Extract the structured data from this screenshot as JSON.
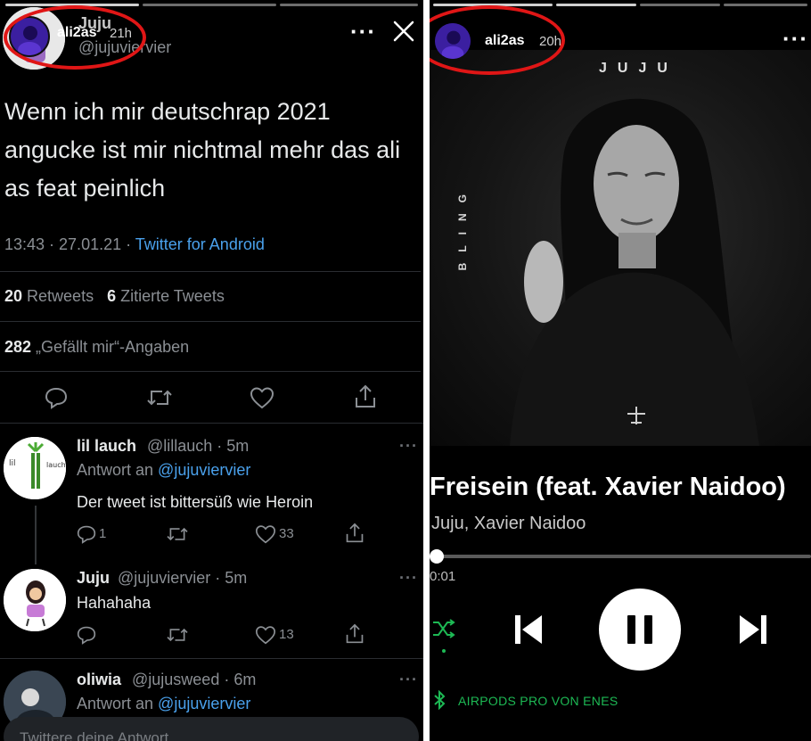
{
  "left_story": {
    "username": "ali2as",
    "time": "21h",
    "more_icon": "more-horizontal-icon",
    "close_icon": "close-icon"
  },
  "tweet": {
    "author_name": "Juju",
    "author_handle": "@jujuviervier",
    "text": "Wenn ich mir deutschrap 2021 angucke ist mir nichtmal mehr das ali as feat peinlich",
    "timestamp": "13:43 · 27.01.21 · ",
    "source": "Twitter for Android",
    "retweets_count": "20",
    "retweets_label": " Retweets",
    "quotes_count": "6",
    "quotes_label": " Zitierte Tweets",
    "likes_count": "282",
    "likes_label": " „Gefällt mir“-Angaben"
  },
  "replies": [
    {
      "name": "lil lauch",
      "handle": "@lillauch · 5m",
      "reply_to_label": "Antwort an ",
      "reply_to_mention": "@jujuviervier",
      "text": "Der tweet ist bittersüß wie Heroin",
      "reply_count": "1",
      "like_count": "33"
    },
    {
      "name": "Juju",
      "handle": "@jujuviervier · 5m",
      "text": "Hahahaha",
      "like_count": "13"
    },
    {
      "name": "oliwia",
      "handle": "@jujusweed · 6m",
      "reply_to_label": "Antwort an ",
      "reply_to_mention": "@jujuviervier"
    }
  ],
  "compose": {
    "placeholder": "Twittere deine Antwort"
  },
  "right_story": {
    "username": "ali2as",
    "time": "20h",
    "more_icon": "more-horizontal-icon"
  },
  "spotify": {
    "cover_artist_text": "JUJU",
    "cover_side_text": "BLING",
    "title": "Freisein (feat. Xavier Naidoo)",
    "artists": "Juju, Xavier Naidoo",
    "elapsed": "0:01",
    "progress_fraction": 0.01,
    "device": "AIRPODS PRO VON ENES",
    "accent_color": "#1db954"
  },
  "colors": {
    "highlight_circle": "#e01616",
    "twitter_link": "#4aa1ec"
  }
}
